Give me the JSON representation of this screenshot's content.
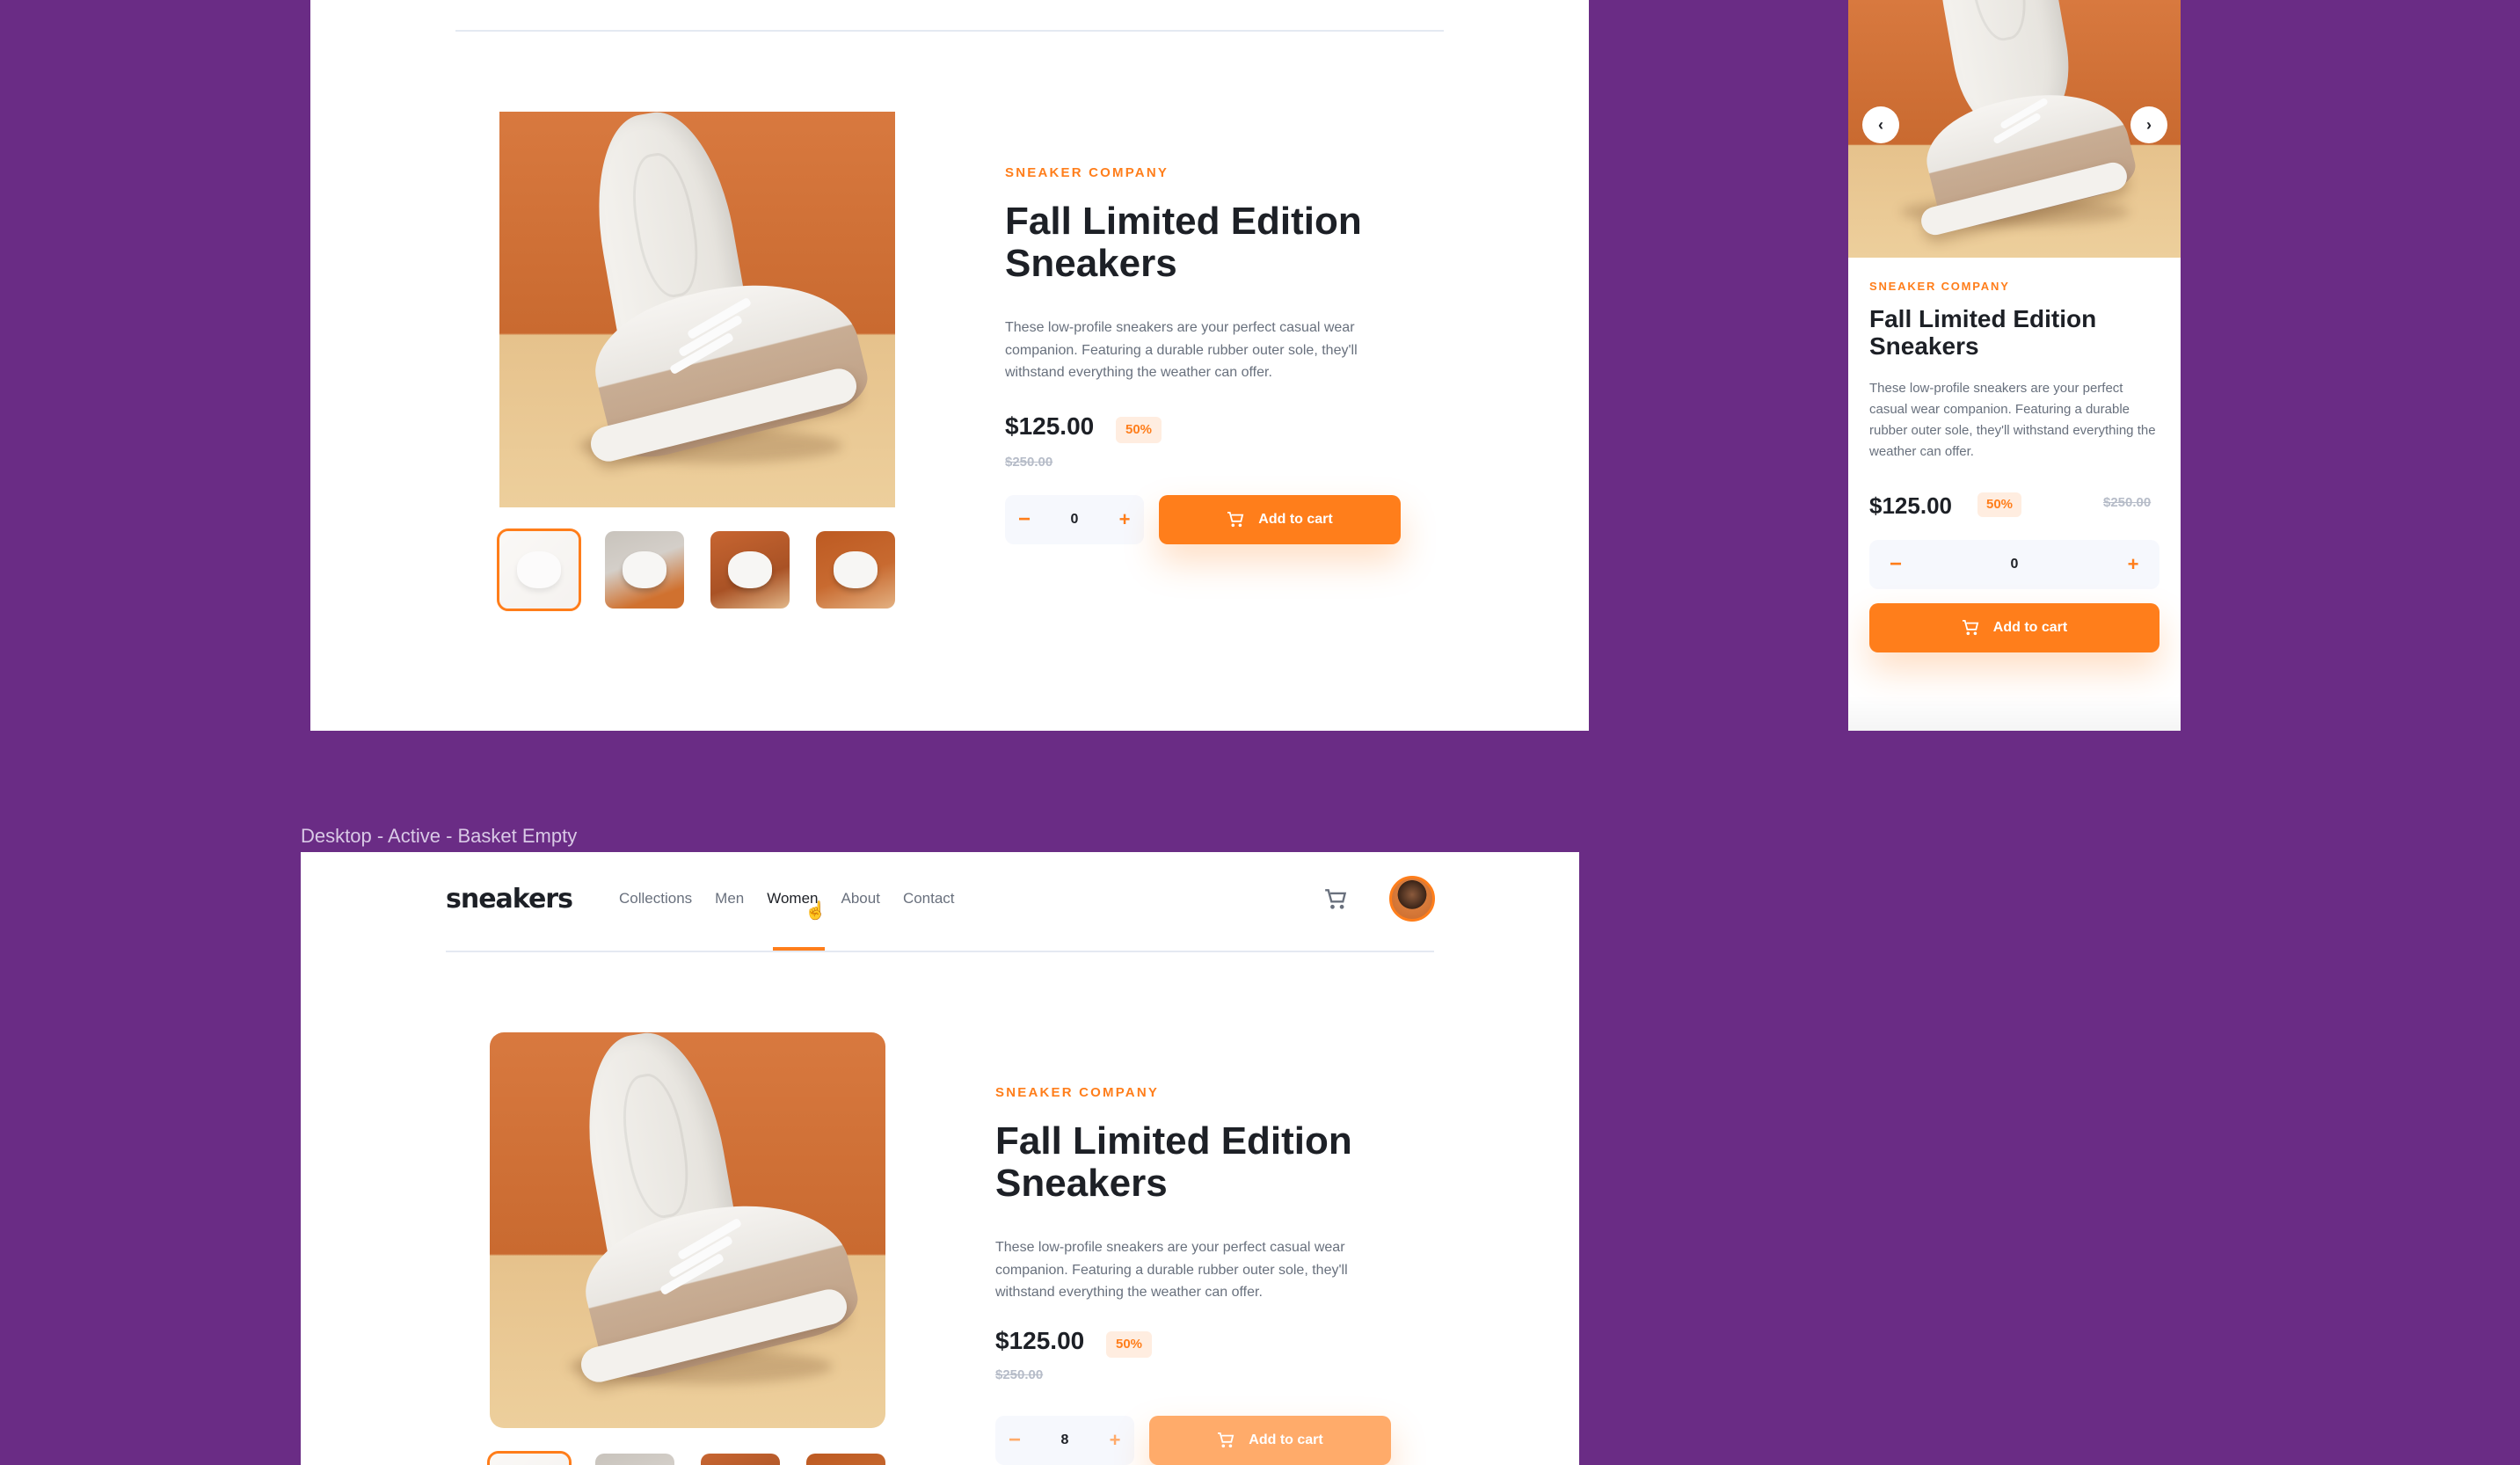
{
  "label": "Desktop - Active - Basket Empty",
  "product": {
    "company": "SNEAKER COMPANY",
    "title_line1": "Fall Limited Edition",
    "title_line2": "Sneakers",
    "description": "These low-profile sneakers are your perfect casual wear companion. Featuring a durable rubber outer sole, they'll withstand everything the weather can offer.",
    "price": "$125.00",
    "discount": "50%",
    "old_price": "$250.00",
    "add_to_cart": "Add to cart"
  },
  "frames": {
    "top_desktop": {
      "quantity": "0"
    },
    "mobile": {
      "quantity": "0",
      "prev_icon": "chevron-left-icon",
      "next_icon": "chevron-right-icon"
    },
    "active_desktop": {
      "quantity": "8"
    }
  },
  "nav": {
    "logo": "sneakers",
    "items": [
      "Collections",
      "Men",
      "Women",
      "About",
      "Contact"
    ],
    "active": "Women",
    "cart_icon": "cart-icon",
    "avatar": "user-avatar"
  },
  "colors": {
    "accent": "#ff7e1b",
    "accent_pale": "#ffede0",
    "text": "#1d2026",
    "muted": "#68707d",
    "background": "#6a2c85"
  }
}
